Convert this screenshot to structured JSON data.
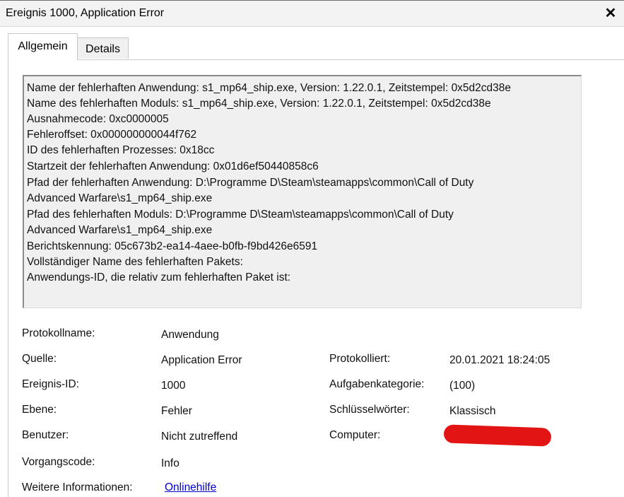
{
  "window": {
    "title": "Ereignis 1000, Application Error",
    "close_glyph": "✕"
  },
  "tabs": [
    {
      "label": "Allgemein",
      "active": true
    },
    {
      "label": "Details",
      "active": false
    }
  ],
  "description_lines": [
    "Name der fehlerhaften Anwendung: s1_mp64_ship.exe, Version: 1.22.0.1, Zeitstempel: 0x5d2cd38e",
    "Name des fehlerhaften Moduls: s1_mp64_ship.exe, Version: 1.22.0.1, Zeitstempel: 0x5d2cd38e",
    "Ausnahmecode: 0xc0000005",
    "Fehleroffset: 0x000000000044f762",
    "ID des fehlerhaften Prozesses: 0x18cc",
    "Startzeit der fehlerhaften Anwendung: 0x01d6ef50440858c6",
    "Pfad der fehlerhaften Anwendung: D:\\Programme D\\Steam\\steamapps\\common\\Call of Duty",
    "Advanced Warfare\\s1_mp64_ship.exe",
    "Pfad des fehlerhaften Moduls: D:\\Programme D\\Steam\\steamapps\\common\\Call of Duty",
    "Advanced Warfare\\s1_mp64_ship.exe",
    "Berichtskennung: 05c673b2-ea14-4aee-b0fb-f9bd426e6591",
    "Vollständiger Name des fehlerhaften Pakets:",
    "Anwendungs-ID, die relativ zum fehlerhaften Paket ist:"
  ],
  "properties": {
    "log_name_label": "Protokollname:",
    "log_name_value": "Anwendung",
    "source_label": "Quelle:",
    "source_value": "Application Error",
    "logged_label": "Protokolliert:",
    "logged_value": "20.01.2021 18:24:05",
    "event_id_label": "Ereignis-ID:",
    "event_id_value": "1000",
    "task_category_label": "Aufgabenkategorie:",
    "task_category_value": "(100)",
    "level_label": "Ebene:",
    "level_value": "Fehler",
    "keywords_label": "Schlüsselwörter:",
    "keywords_value": "Klassisch",
    "user_label": "Benutzer:",
    "user_value": "Nicht zutreffend",
    "computer_label": "Computer:",
    "opcode_label": "Vorgangscode:",
    "opcode_value": "Info",
    "more_info_label": "Weitere Informationen:",
    "more_info_link": "Onlinehilfe"
  },
  "colors": {
    "redaction": "#e31414",
    "link": "#0000cc"
  }
}
